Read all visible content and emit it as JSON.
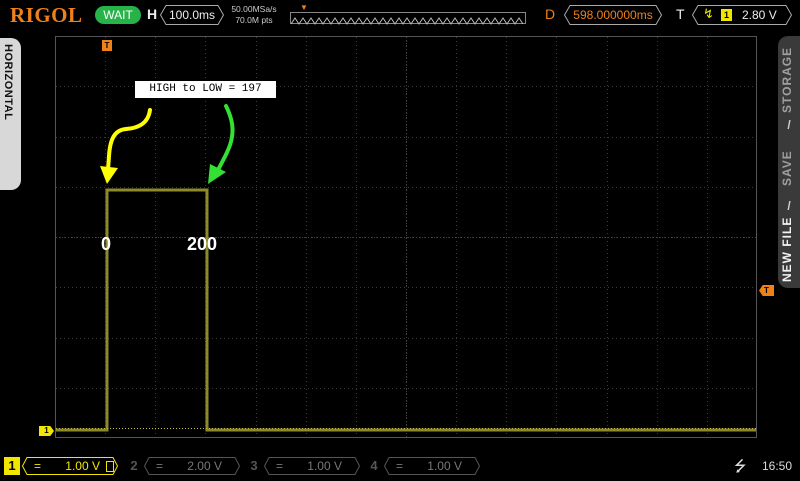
{
  "top_bar": {
    "logo": "RIGOL",
    "run_status": "WAIT",
    "horizontal_label": "H",
    "timebase": "100.0ms",
    "sample_rate": "50.00MSa/s",
    "memory_depth": "70.0M pts",
    "delay_label": "D",
    "delay_value": "598.000000ms",
    "trigger_label": "T",
    "trigger_source": "1",
    "trigger_level": "2.80 V"
  },
  "side_menu": {
    "left_tab": "HORIZONTAL",
    "right_tabs": [
      "STORAGE",
      "SAVE",
      "NEW FILE"
    ],
    "separator": "/"
  },
  "markers": {
    "trigger_position": "T",
    "trigger_level": "T",
    "ch1_offset": "1"
  },
  "annotations": {
    "callout": "HIGH to LOW = 197",
    "start_label": "0",
    "end_label": "200"
  },
  "channels": [
    {
      "number": "1",
      "coupling": "=",
      "scale": "1.00 V",
      "active": true
    },
    {
      "number": "2",
      "coupling": "=",
      "scale": "2.00 V",
      "active": false
    },
    {
      "number": "3",
      "coupling": "=",
      "scale": "1.00 V",
      "active": false
    },
    {
      "number": "4",
      "coupling": "=",
      "scale": "1.00 V",
      "active": false
    }
  ],
  "bottom_bar": {
    "clock": "16:50"
  },
  "colors": {
    "ch1": "#f2e600",
    "waveform": "#8c8a2a",
    "accent": "#f08018",
    "run_status": "#27b24a",
    "arrow_yellow": "#ffff00",
    "arrow_green": "#33e033"
  }
}
